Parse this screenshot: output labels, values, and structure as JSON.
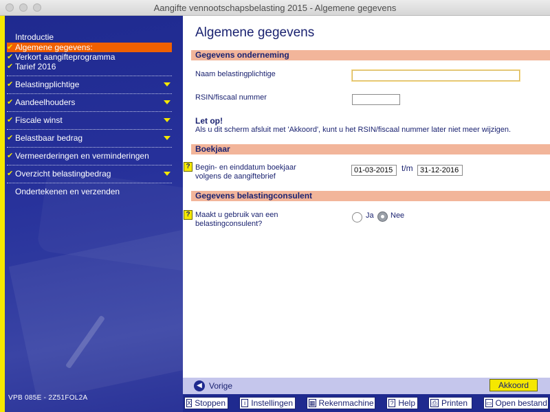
{
  "window": {
    "title": "Aangifte vennootschapsbelasting 2015 - Algemene gegevens"
  },
  "sidebar": {
    "items": [
      {
        "label": "Introductie",
        "checked": false,
        "active": false,
        "expandable": false
      },
      {
        "label": "Algemene gegevens:",
        "checked": true,
        "active": true,
        "expandable": false
      },
      {
        "label": "Verkort aangifteprogramma",
        "checked": true,
        "active": false,
        "expandable": false
      },
      {
        "label": "Tarief 2016",
        "checked": true,
        "active": false,
        "expandable": false
      },
      {
        "label": "Belastingplichtige",
        "checked": true,
        "active": false,
        "expandable": true
      },
      {
        "label": "Aandeelhouders",
        "checked": true,
        "active": false,
        "expandable": true
      },
      {
        "label": "Fiscale winst",
        "checked": true,
        "active": false,
        "expandable": true
      },
      {
        "label": "Belastbaar bedrag",
        "checked": true,
        "active": false,
        "expandable": true
      },
      {
        "label": "Vermeerderingen en verminderingen",
        "checked": true,
        "active": false,
        "expandable": false
      },
      {
        "label": "Overzicht belastingbedrag",
        "checked": true,
        "active": false,
        "expandable": true
      },
      {
        "label": "Ondertekenen en verzenden",
        "checked": false,
        "active": false,
        "expandable": false
      }
    ],
    "build_label": "VPB 085E - 2Z51FOL2A",
    "check_color": "#f5e800",
    "active_color": "#f06000"
  },
  "main": {
    "page_title": "Algemene gegevens",
    "sections": {
      "onderneming": "Gegevens onderneming",
      "boekjaar": "Boekjaar",
      "consulent": "Gegevens belastingconsulent"
    },
    "fields": {
      "naam_label": "Naam belastingplichtige",
      "naam_value": "",
      "rsin_label": "RSIN/fiscaal nummer",
      "rsin_value": "",
      "begin_label_1": "Begin- en einddatum boekjaar",
      "begin_label_2": "volgens de aangiftebrief",
      "begin_date": "01-03-2015",
      "tm": "t/m",
      "end_date": "31-12-2016",
      "consulent_label_1": "Maakt u gebruik van een",
      "consulent_label_2": "belastingconsulent?",
      "option_ja": "Ja",
      "option_nee": "Nee",
      "selected_option": "Nee"
    },
    "warning": {
      "title": "Let op!",
      "text": "Als u dit scherm afsluit met 'Akkoord', kunt u het RSIN/fiscaal nummer later niet meer wijzigen."
    },
    "help_glyph": "?"
  },
  "footer": {
    "back_label": "Vorige",
    "accept_label": "Akkoord",
    "tools": [
      {
        "label": "Stoppen",
        "icon": "close-icon",
        "glyph": "X"
      },
      {
        "label": "Instellingen",
        "icon": "info-icon",
        "glyph": "i"
      },
      {
        "label": "Rekenmachine",
        "icon": "calculator-icon",
        "glyph": "▦"
      },
      {
        "label": "Help",
        "icon": "help-icon",
        "glyph": "?"
      },
      {
        "label": "Printen",
        "icon": "printer-icon",
        "glyph": "⎙"
      },
      {
        "label": "Open bestand",
        "icon": "folder-icon",
        "glyph": "▭"
      }
    ]
  },
  "colors": {
    "sidebar_bg": "#1f2a8f",
    "section_bar": "#f2b59a",
    "text_navy": "#1a2270",
    "accent_yellow": "#f5e800"
  }
}
